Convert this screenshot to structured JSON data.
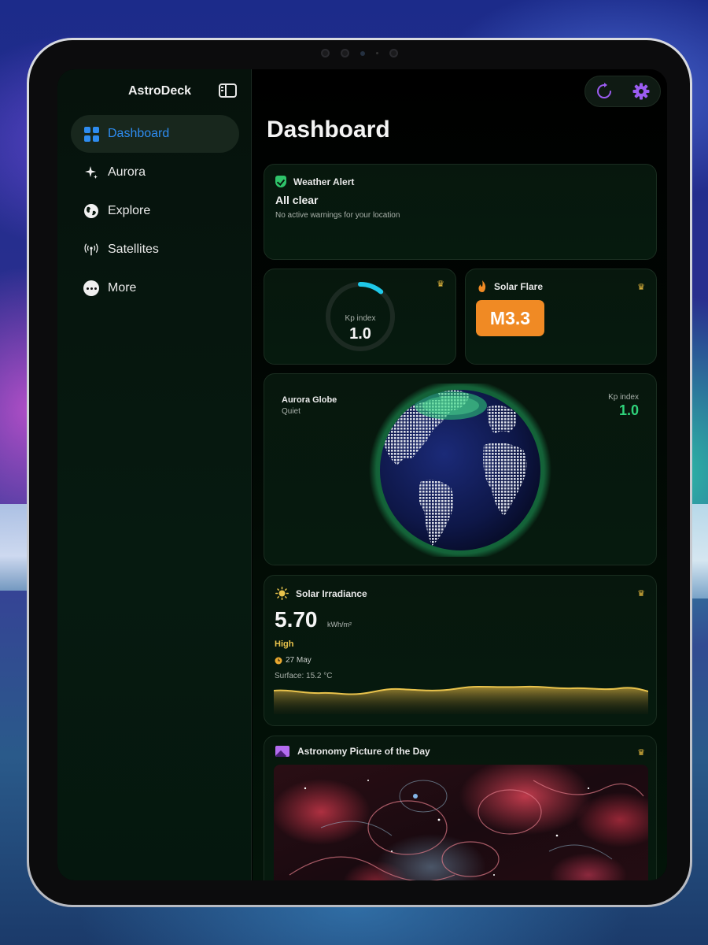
{
  "app": {
    "title": "AstroDeck"
  },
  "sidebar": {
    "items": [
      {
        "label": "Dashboard",
        "icon": "grid-icon",
        "active": true
      },
      {
        "label": "Aurora",
        "icon": "sparkle-icon"
      },
      {
        "label": "Explore",
        "icon": "globe-icon"
      },
      {
        "label": "Satellites",
        "icon": "antenna-icon"
      },
      {
        "label": "More",
        "icon": "more-icon"
      }
    ]
  },
  "toolbar": {
    "refresh_icon": "refresh-icon",
    "settings_icon": "gear-icon"
  },
  "page": {
    "title": "Dashboard"
  },
  "weather_alert": {
    "title": "Weather Alert",
    "status": "All clear",
    "message": "No active warnings for your location"
  },
  "kp": {
    "label": "Kp index",
    "value": "1.0",
    "ring_fraction": 0.11
  },
  "solar_flare": {
    "title": "Solar Flare",
    "value": "M3.3"
  },
  "aurora_globe": {
    "title": "Aurora Globe",
    "subtitle": "Quiet",
    "kp_label": "Kp index",
    "kp_value": "1.0"
  },
  "solar_irradiance": {
    "title": "Solar Irradiance",
    "value": "5.70",
    "unit": "kWh/m²",
    "level": "High",
    "date": "27 May",
    "surface": "Surface: 15.2 °C"
  },
  "apod": {
    "title": "Astronomy Picture of the Day"
  },
  "colors": {
    "accent_blue": "#2e8cf0",
    "kp_cyan": "#1fc8e8",
    "flare_orange": "#f08a24",
    "irradiance_gold": "#e9c34c",
    "aurora_green": "#2fd27a"
  }
}
